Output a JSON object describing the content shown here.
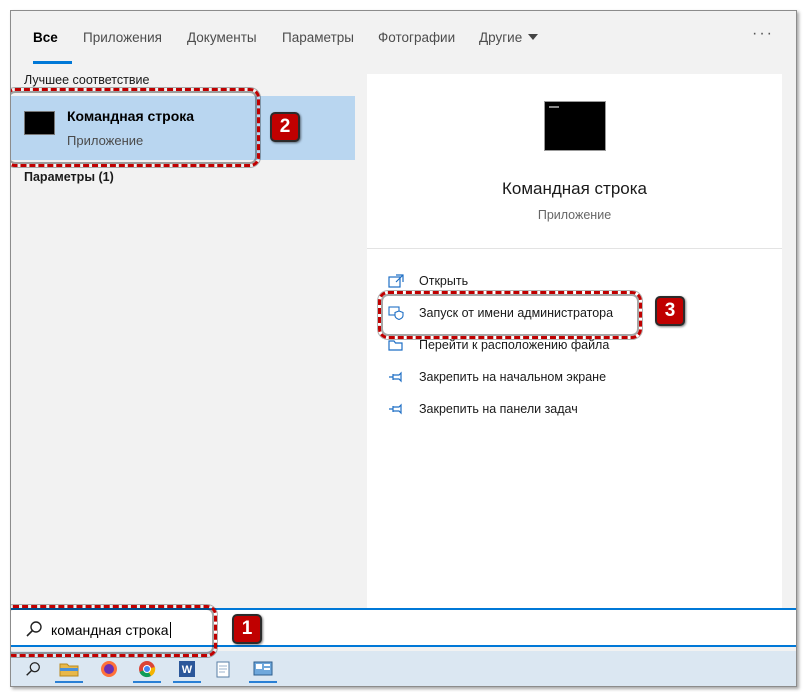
{
  "tabs": [
    {
      "label": "Все"
    },
    {
      "label": "Приложения"
    },
    {
      "label": "Документы"
    },
    {
      "label": "Параметры"
    },
    {
      "label": "Фотографии"
    },
    {
      "label": "Другие"
    }
  ],
  "more_label": "···",
  "left": {
    "best_match_header": "Лучшее соответствие",
    "best_match": {
      "title": "Командная строка",
      "subtitle": "Приложение",
      "icon": "cmd-icon"
    },
    "settings_header": "Параметры (1)"
  },
  "preview": {
    "title": "Командная строка",
    "subtitle": "Приложение",
    "actions": [
      {
        "label": "Открыть",
        "icon": "open-icon"
      },
      {
        "label": "Запуск от имени администратора",
        "icon": "shield-icon"
      },
      {
        "label": "Перейти к расположению файла",
        "icon": "folder-icon"
      },
      {
        "label": "Закрепить на начальном экране",
        "icon": "pin-icon"
      },
      {
        "label": "Закрепить на панели задач",
        "icon": "pin-icon"
      }
    ]
  },
  "search": {
    "value": "командная строка"
  },
  "annotations": [
    "1",
    "2",
    "3"
  ],
  "colors": {
    "accent": "#0078d7",
    "selected": "#b9d6f0",
    "annotation": "#c00000"
  }
}
